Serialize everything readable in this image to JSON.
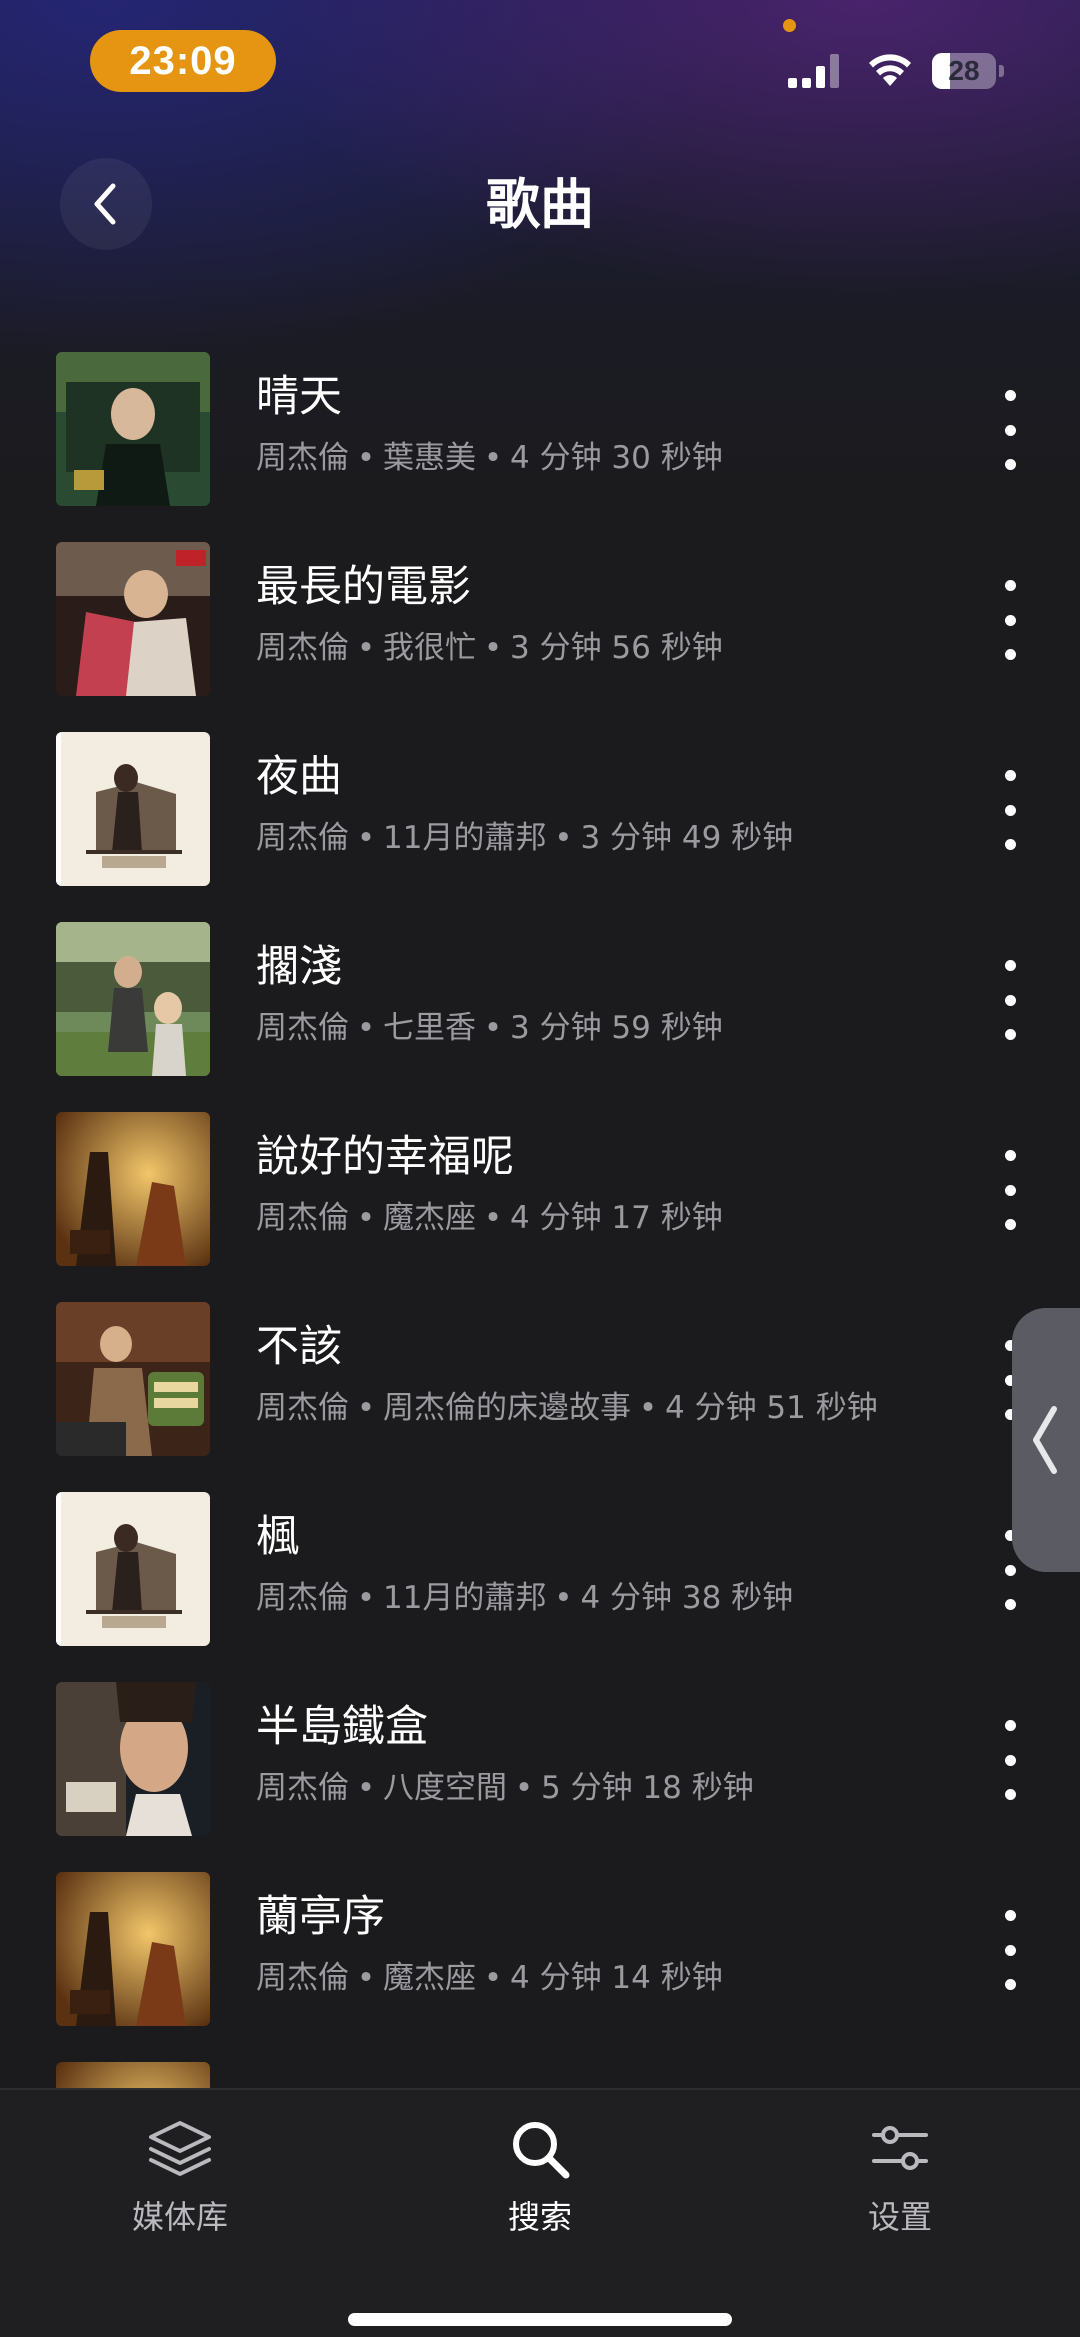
{
  "status_bar": {
    "time": "23:09",
    "battery_level": "28",
    "battery_fraction": 0.28,
    "icons": [
      "signal-icon",
      "wifi-icon",
      "battery-icon"
    ]
  },
  "header": {
    "title": "歌曲",
    "back_icon": "chevron-left-icon"
  },
  "songs": [
    {
      "title": "晴天",
      "artist": "周杰倫",
      "album": "葉惠美",
      "duration": "4 分钟 30 秒钟"
    },
    {
      "title": "最長的電影",
      "artist": "周杰倫",
      "album": "我很忙",
      "duration": "3 分钟 56 秒钟"
    },
    {
      "title": "夜曲",
      "artist": "周杰倫",
      "album": "11月的蕭邦",
      "duration": "3 分钟 49 秒钟"
    },
    {
      "title": "擱淺",
      "artist": "周杰倫",
      "album": "七里香",
      "duration": "3 分钟 59 秒钟"
    },
    {
      "title": "說好的幸福呢",
      "artist": "周杰倫",
      "album": "魔杰座",
      "duration": "4 分钟 17 秒钟"
    },
    {
      "title": "不該",
      "artist": "周杰倫",
      "album": "周杰倫的床邊故事",
      "duration": "4 分钟 51 秒钟"
    },
    {
      "title": "楓",
      "artist": "周杰倫",
      "album": "11月的蕭邦",
      "duration": "4 分钟 38 秒钟"
    },
    {
      "title": "半島鐵盒",
      "artist": "周杰倫",
      "album": "八度空間",
      "duration": "5 分钟 18 秒钟"
    },
    {
      "title": "蘭亭序",
      "artist": "周杰倫",
      "album": "魔杰座",
      "duration": "4 分钟 14 秒钟"
    }
  ],
  "tab_bar": {
    "tabs": [
      {
        "label": "媒体库",
        "icon": "layers-icon",
        "active": false
      },
      {
        "label": "搜索",
        "icon": "search-icon",
        "active": true
      },
      {
        "label": "设置",
        "icon": "sliders-icon",
        "active": false
      }
    ]
  },
  "colors": {
    "accent_time_pill": "#e59512",
    "background": "#1b1b1d",
    "secondary_text": "#9a9a9f",
    "tab_inactive": "#b9b9be"
  }
}
